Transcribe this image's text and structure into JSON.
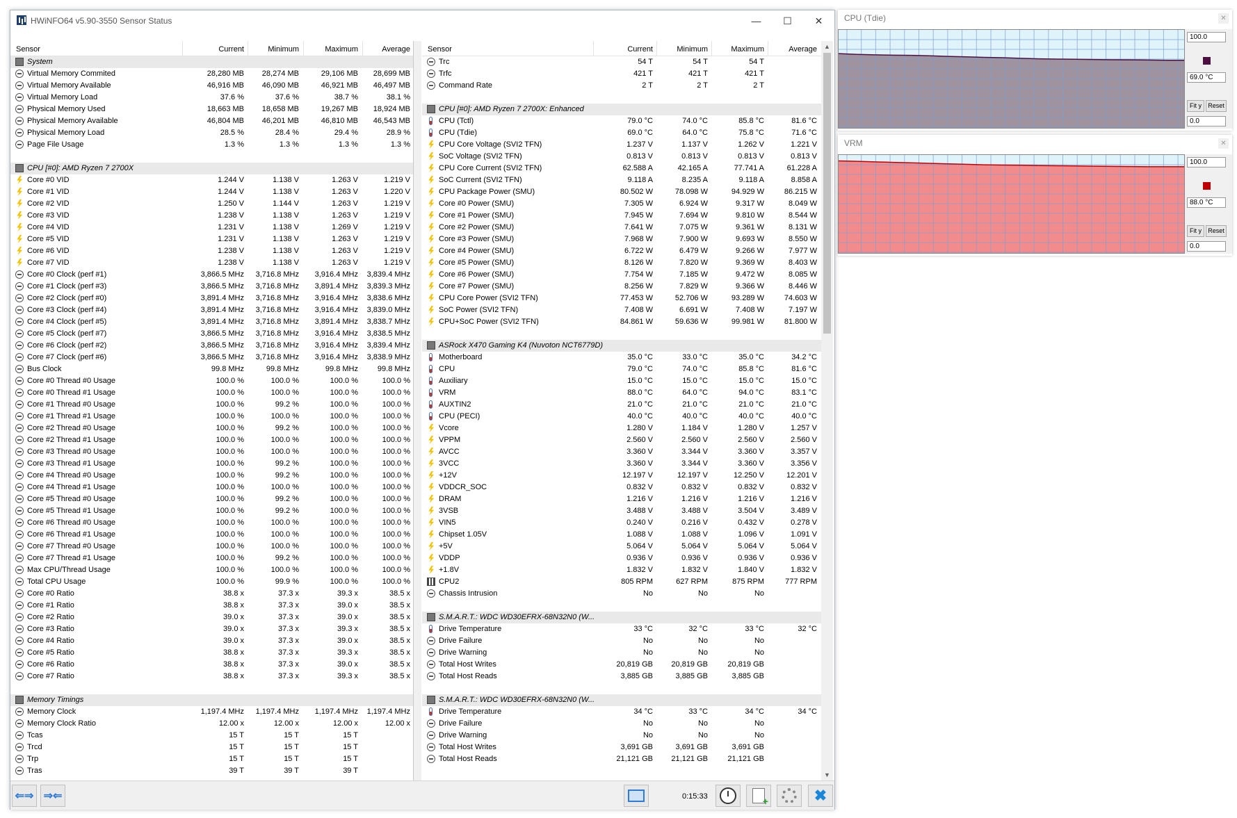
{
  "window": {
    "title": "HWiNFO64 v5.90-3550 Sensor Status",
    "minimize": "—",
    "maximize": "☐",
    "close": "✕"
  },
  "columns": {
    "sensor": "Sensor",
    "current": "Current",
    "minimum": "Minimum",
    "maximum": "Maximum",
    "average": "Average"
  },
  "left_rows": [
    {
      "g": true,
      "n": "System"
    },
    {
      "i": "c",
      "n": "Virtual Memory Commited",
      "c": "28,280 MB",
      "mi": "28,274 MB",
      "ma": "29,106 MB",
      "a": "28,699 MB"
    },
    {
      "i": "c",
      "n": "Virtual Memory Available",
      "c": "46,916 MB",
      "mi": "46,090 MB",
      "ma": "46,921 MB",
      "a": "46,497 MB"
    },
    {
      "i": "c",
      "n": "Virtual Memory Load",
      "c": "37.6 %",
      "mi": "37.6 %",
      "ma": "38.7 %",
      "a": "38.1 %"
    },
    {
      "i": "c",
      "n": "Physical Memory Used",
      "c": "18,663 MB",
      "mi": "18,658 MB",
      "ma": "19,267 MB",
      "a": "18,924 MB"
    },
    {
      "i": "c",
      "n": "Physical Memory Available",
      "c": "46,804 MB",
      "mi": "46,201 MB",
      "ma": "46,810 MB",
      "a": "46,543 MB"
    },
    {
      "i": "c",
      "n": "Physical Memory Load",
      "c": "28.5 %",
      "mi": "28.4 %",
      "ma": "29.4 %",
      "a": "28.9 %"
    },
    {
      "i": "c",
      "n": "Page File Usage",
      "c": "1.3 %",
      "mi": "1.3 %",
      "ma": "1.3 %",
      "a": "1.3 %"
    },
    {
      "b": true
    },
    {
      "g": true,
      "n": "CPU [#0]: AMD Ryzen 7 2700X"
    },
    {
      "i": "b",
      "n": "Core #0 VID",
      "c": "1.244 V",
      "mi": "1.138 V",
      "ma": "1.263 V",
      "a": "1.219 V"
    },
    {
      "i": "b",
      "n": "Core #1 VID",
      "c": "1.244 V",
      "mi": "1.138 V",
      "ma": "1.263 V",
      "a": "1.220 V"
    },
    {
      "i": "b",
      "n": "Core #2 VID",
      "c": "1.250 V",
      "mi": "1.144 V",
      "ma": "1.263 V",
      "a": "1.219 V"
    },
    {
      "i": "b",
      "n": "Core #3 VID",
      "c": "1.238 V",
      "mi": "1.138 V",
      "ma": "1.263 V",
      "a": "1.219 V"
    },
    {
      "i": "b",
      "n": "Core #4 VID",
      "c": "1.231 V",
      "mi": "1.138 V",
      "ma": "1.269 V",
      "a": "1.219 V"
    },
    {
      "i": "b",
      "n": "Core #5 VID",
      "c": "1.231 V",
      "mi": "1.138 V",
      "ma": "1.263 V",
      "a": "1.219 V"
    },
    {
      "i": "b",
      "n": "Core #6 VID",
      "c": "1.238 V",
      "mi": "1.138 V",
      "ma": "1.263 V",
      "a": "1.219 V"
    },
    {
      "i": "b",
      "n": "Core #7 VID",
      "c": "1.238 V",
      "mi": "1.138 V",
      "ma": "1.263 V",
      "a": "1.219 V"
    },
    {
      "i": "c",
      "n": "Core #0 Clock (perf #1)",
      "c": "3,866.5 MHz",
      "mi": "3,716.8 MHz",
      "ma": "3,916.4 MHz",
      "a": "3,839.4 MHz"
    },
    {
      "i": "c",
      "n": "Core #1 Clock (perf #3)",
      "c": "3,866.5 MHz",
      "mi": "3,716.8 MHz",
      "ma": "3,891.4 MHz",
      "a": "3,839.3 MHz"
    },
    {
      "i": "c",
      "n": "Core #2 Clock (perf #0)",
      "c": "3,891.4 MHz",
      "mi": "3,716.8 MHz",
      "ma": "3,916.4 MHz",
      "a": "3,838.6 MHz"
    },
    {
      "i": "c",
      "n": "Core #3 Clock (perf #4)",
      "c": "3,891.4 MHz",
      "mi": "3,716.8 MHz",
      "ma": "3,916.4 MHz",
      "a": "3,839.0 MHz"
    },
    {
      "i": "c",
      "n": "Core #4 Clock (perf #5)",
      "c": "3,891.4 MHz",
      "mi": "3,716.8 MHz",
      "ma": "3,891.4 MHz",
      "a": "3,838.7 MHz"
    },
    {
      "i": "c",
      "n": "Core #5 Clock (perf #7)",
      "c": "3,866.5 MHz",
      "mi": "3,716.8 MHz",
      "ma": "3,916.4 MHz",
      "a": "3,838.5 MHz"
    },
    {
      "i": "c",
      "n": "Core #6 Clock (perf #2)",
      "c": "3,866.5 MHz",
      "mi": "3,716.8 MHz",
      "ma": "3,916.4 MHz",
      "a": "3,839.4 MHz"
    },
    {
      "i": "c",
      "n": "Core #7 Clock (perf #6)",
      "c": "3,866.5 MHz",
      "mi": "3,716.8 MHz",
      "ma": "3,916.4 MHz",
      "a": "3,838.9 MHz"
    },
    {
      "i": "c",
      "n": "Bus Clock",
      "c": "99.8 MHz",
      "mi": "99.8 MHz",
      "ma": "99.8 MHz",
      "a": "99.8 MHz"
    },
    {
      "i": "c",
      "n": "Core #0 Thread #0 Usage",
      "c": "100.0 %",
      "mi": "100.0 %",
      "ma": "100.0 %",
      "a": "100.0 %"
    },
    {
      "i": "c",
      "n": "Core #0 Thread #1 Usage",
      "c": "100.0 %",
      "mi": "100.0 %",
      "ma": "100.0 %",
      "a": "100.0 %"
    },
    {
      "i": "c",
      "n": "Core #1 Thread #0 Usage",
      "c": "100.0 %",
      "mi": "99.2 %",
      "ma": "100.0 %",
      "a": "100.0 %"
    },
    {
      "i": "c",
      "n": "Core #1 Thread #1 Usage",
      "c": "100.0 %",
      "mi": "100.0 %",
      "ma": "100.0 %",
      "a": "100.0 %"
    },
    {
      "i": "c",
      "n": "Core #2 Thread #0 Usage",
      "c": "100.0 %",
      "mi": "99.2 %",
      "ma": "100.0 %",
      "a": "100.0 %"
    },
    {
      "i": "c",
      "n": "Core #2 Thread #1 Usage",
      "c": "100.0 %",
      "mi": "100.0 %",
      "ma": "100.0 %",
      "a": "100.0 %"
    },
    {
      "i": "c",
      "n": "Core #3 Thread #0 Usage",
      "c": "100.0 %",
      "mi": "100.0 %",
      "ma": "100.0 %",
      "a": "100.0 %"
    },
    {
      "i": "c",
      "n": "Core #3 Thread #1 Usage",
      "c": "100.0 %",
      "mi": "99.2 %",
      "ma": "100.0 %",
      "a": "100.0 %"
    },
    {
      "i": "c",
      "n": "Core #4 Thread #0 Usage",
      "c": "100.0 %",
      "mi": "99.2 %",
      "ma": "100.0 %",
      "a": "100.0 %"
    },
    {
      "i": "c",
      "n": "Core #4 Thread #1 Usage",
      "c": "100.0 %",
      "mi": "100.0 %",
      "ma": "100.0 %",
      "a": "100.0 %"
    },
    {
      "i": "c",
      "n": "Core #5 Thread #0 Usage",
      "c": "100.0 %",
      "mi": "99.2 %",
      "ma": "100.0 %",
      "a": "100.0 %"
    },
    {
      "i": "c",
      "n": "Core #5 Thread #1 Usage",
      "c": "100.0 %",
      "mi": "99.2 %",
      "ma": "100.0 %",
      "a": "100.0 %"
    },
    {
      "i": "c",
      "n": "Core #6 Thread #0 Usage",
      "c": "100.0 %",
      "mi": "100.0 %",
      "ma": "100.0 %",
      "a": "100.0 %"
    },
    {
      "i": "c",
      "n": "Core #6 Thread #1 Usage",
      "c": "100.0 %",
      "mi": "100.0 %",
      "ma": "100.0 %",
      "a": "100.0 %"
    },
    {
      "i": "c",
      "n": "Core #7 Thread #0 Usage",
      "c": "100.0 %",
      "mi": "100.0 %",
      "ma": "100.0 %",
      "a": "100.0 %"
    },
    {
      "i": "c",
      "n": "Core #7 Thread #1 Usage",
      "c": "100.0 %",
      "mi": "99.2 %",
      "ma": "100.0 %",
      "a": "100.0 %"
    },
    {
      "i": "c",
      "n": "Max CPU/Thread Usage",
      "c": "100.0 %",
      "mi": "100.0 %",
      "ma": "100.0 %",
      "a": "100.0 %"
    },
    {
      "i": "c",
      "n": "Total CPU Usage",
      "c": "100.0 %",
      "mi": "99.9 %",
      "ma": "100.0 %",
      "a": "100.0 %"
    },
    {
      "i": "c",
      "n": "Core #0 Ratio",
      "c": "38.8 x",
      "mi": "37.3 x",
      "ma": "39.3 x",
      "a": "38.5 x"
    },
    {
      "i": "c",
      "n": "Core #1 Ratio",
      "c": "38.8 x",
      "mi": "37.3 x",
      "ma": "39.0 x",
      "a": "38.5 x"
    },
    {
      "i": "c",
      "n": "Core #2 Ratio",
      "c": "39.0 x",
      "mi": "37.3 x",
      "ma": "39.0 x",
      "a": "38.5 x"
    },
    {
      "i": "c",
      "n": "Core #3 Ratio",
      "c": "39.0 x",
      "mi": "37.3 x",
      "ma": "39.3 x",
      "a": "38.5 x"
    },
    {
      "i": "c",
      "n": "Core #4 Ratio",
      "c": "39.0 x",
      "mi": "37.3 x",
      "ma": "39.0 x",
      "a": "38.5 x"
    },
    {
      "i": "c",
      "n": "Core #5 Ratio",
      "c": "38.8 x",
      "mi": "37.3 x",
      "ma": "39.3 x",
      "a": "38.5 x"
    },
    {
      "i": "c",
      "n": "Core #6 Ratio",
      "c": "38.8 x",
      "mi": "37.3 x",
      "ma": "39.0 x",
      "a": "38.5 x"
    },
    {
      "i": "c",
      "n": "Core #7 Ratio",
      "c": "38.8 x",
      "mi": "37.3 x",
      "ma": "39.3 x",
      "a": "38.5 x"
    },
    {
      "b": true
    },
    {
      "g": true,
      "n": "Memory Timings"
    },
    {
      "i": "c",
      "n": "Memory Clock",
      "c": "1,197.4 MHz",
      "mi": "1,197.4 MHz",
      "ma": "1,197.4 MHz",
      "a": "1,197.4 MHz"
    },
    {
      "i": "c",
      "n": "Memory Clock Ratio",
      "c": "12.00 x",
      "mi": "12.00 x",
      "ma": "12.00 x",
      "a": "12.00 x"
    },
    {
      "i": "c",
      "n": "Tcas",
      "c": "15 T",
      "mi": "15 T",
      "ma": "15 T",
      "a": ""
    },
    {
      "i": "c",
      "n": "Trcd",
      "c": "15 T",
      "mi": "15 T",
      "ma": "15 T",
      "a": ""
    },
    {
      "i": "c",
      "n": "Trp",
      "c": "15 T",
      "mi": "15 T",
      "ma": "15 T",
      "a": ""
    },
    {
      "i": "c",
      "n": "Tras",
      "c": "39 T",
      "mi": "39 T",
      "ma": "39 T",
      "a": ""
    }
  ],
  "right_rows": [
    {
      "i": "c",
      "n": "Trc",
      "c": "54 T",
      "mi": "54 T",
      "ma": "54 T",
      "a": ""
    },
    {
      "i": "c",
      "n": "Trfc",
      "c": "421 T",
      "mi": "421 T",
      "ma": "421 T",
      "a": ""
    },
    {
      "i": "c",
      "n": "Command Rate",
      "c": "2 T",
      "mi": "2 T",
      "ma": "2 T",
      "a": ""
    },
    {
      "b": true
    },
    {
      "g": true,
      "n": "CPU [#0]: AMD Ryzen 7 2700X: Enhanced"
    },
    {
      "i": "t",
      "n": "CPU (Tctl)",
      "c": "79.0 °C",
      "mi": "74.0 °C",
      "ma": "85.8 °C",
      "a": "81.6 °C"
    },
    {
      "i": "t",
      "n": "CPU (Tdie)",
      "c": "69.0 °C",
      "mi": "64.0 °C",
      "ma": "75.8 °C",
      "a": "71.6 °C"
    },
    {
      "i": "b",
      "n": "CPU Core Voltage (SVI2 TFN)",
      "c": "1.237 V",
      "mi": "1.137 V",
      "ma": "1.262 V",
      "a": "1.221 V"
    },
    {
      "i": "b",
      "n": "SoC Voltage (SVI2 TFN)",
      "c": "0.813 V",
      "mi": "0.813 V",
      "ma": "0.813 V",
      "a": "0.813 V"
    },
    {
      "i": "b",
      "n": "CPU Core Current (SVI2 TFN)",
      "c": "62.588 A",
      "mi": "42.165 A",
      "ma": "77.741 A",
      "a": "61.228 A"
    },
    {
      "i": "b",
      "n": "SoC Current (SVI2 TFN)",
      "c": "9.118 A",
      "mi": "8.235 A",
      "ma": "9.118 A",
      "a": "8.858 A"
    },
    {
      "i": "b",
      "n": "CPU Package Power (SMU)",
      "c": "80.502 W",
      "mi": "78.098 W",
      "ma": "94.929 W",
      "a": "86.215 W"
    },
    {
      "i": "b",
      "n": "Core #0 Power (SMU)",
      "c": "7.305 W",
      "mi": "6.924 W",
      "ma": "9.317 W",
      "a": "8.049 W"
    },
    {
      "i": "b",
      "n": "Core #1 Power (SMU)",
      "c": "7.945 W",
      "mi": "7.694 W",
      "ma": "9.810 W",
      "a": "8.544 W"
    },
    {
      "i": "b",
      "n": "Core #2 Power (SMU)",
      "c": "7.641 W",
      "mi": "7.075 W",
      "ma": "9.361 W",
      "a": "8.131 W"
    },
    {
      "i": "b",
      "n": "Core #3 Power (SMU)",
      "c": "7.968 W",
      "mi": "7.900 W",
      "ma": "9.693 W",
      "a": "8.550 W"
    },
    {
      "i": "b",
      "n": "Core #4 Power (SMU)",
      "c": "6.722 W",
      "mi": "6.479 W",
      "ma": "9.266 W",
      "a": "7.977 W"
    },
    {
      "i": "b",
      "n": "Core #5 Power (SMU)",
      "c": "8.126 W",
      "mi": "7.820 W",
      "ma": "9.369 W",
      "a": "8.403 W"
    },
    {
      "i": "b",
      "n": "Core #6 Power (SMU)",
      "c": "7.754 W",
      "mi": "7.185 W",
      "ma": "9.472 W",
      "a": "8.085 W"
    },
    {
      "i": "b",
      "n": "Core #7 Power (SMU)",
      "c": "8.256 W",
      "mi": "7.829 W",
      "ma": "9.366 W",
      "a": "8.446 W"
    },
    {
      "i": "b",
      "n": "CPU Core Power (SVI2 TFN)",
      "c": "77.453 W",
      "mi": "52.706 W",
      "ma": "93.289 W",
      "a": "74.603 W"
    },
    {
      "i": "b",
      "n": "SoC Power (SVI2 TFN)",
      "c": "7.408 W",
      "mi": "6.691 W",
      "ma": "7.408 W",
      "a": "7.197 W"
    },
    {
      "i": "b",
      "n": "CPU+SoC Power (SVI2 TFN)",
      "c": "84.861 W",
      "mi": "59.636 W",
      "ma": "99.981 W",
      "a": "81.800 W"
    },
    {
      "b": true
    },
    {
      "g": true,
      "n": "ASRock X470 Gaming K4 (Nuvoton NCT6779D)"
    },
    {
      "i": "t",
      "n": "Motherboard",
      "c": "35.0 °C",
      "mi": "33.0 °C",
      "ma": "35.0 °C",
      "a": "34.2 °C"
    },
    {
      "i": "t",
      "n": "CPU",
      "c": "79.0 °C",
      "mi": "74.0 °C",
      "ma": "85.8 °C",
      "a": "81.6 °C"
    },
    {
      "i": "t",
      "n": "Auxiliary",
      "c": "15.0 °C",
      "mi": "15.0 °C",
      "ma": "15.0 °C",
      "a": "15.0 °C"
    },
    {
      "i": "t",
      "n": "VRM",
      "c": "88.0 °C",
      "mi": "64.0 °C",
      "ma": "94.0 °C",
      "a": "83.1 °C"
    },
    {
      "i": "t",
      "n": "AUXTIN2",
      "c": "21.0 °C",
      "mi": "21.0 °C",
      "ma": "21.0 °C",
      "a": "21.0 °C"
    },
    {
      "i": "t",
      "n": "CPU (PECI)",
      "c": "40.0 °C",
      "mi": "40.0 °C",
      "ma": "40.0 °C",
      "a": "40.0 °C"
    },
    {
      "i": "b",
      "n": "Vcore",
      "c": "1.280 V",
      "mi": "1.184 V",
      "ma": "1.280 V",
      "a": "1.257 V"
    },
    {
      "i": "b",
      "n": "VPPM",
      "c": "2.560 V",
      "mi": "2.560 V",
      "ma": "2.560 V",
      "a": "2.560 V"
    },
    {
      "i": "b",
      "n": "AVCC",
      "c": "3.360 V",
      "mi": "3.344 V",
      "ma": "3.360 V",
      "a": "3.357 V"
    },
    {
      "i": "b",
      "n": "3VCC",
      "c": "3.360 V",
      "mi": "3.344 V",
      "ma": "3.360 V",
      "a": "3.356 V"
    },
    {
      "i": "b",
      "n": "+12V",
      "c": "12.197 V",
      "mi": "12.197 V",
      "ma": "12.250 V",
      "a": "12.201 V"
    },
    {
      "i": "b",
      "n": "VDDCR_SOC",
      "c": "0.832 V",
      "mi": "0.832 V",
      "ma": "0.832 V",
      "a": "0.832 V"
    },
    {
      "i": "b",
      "n": "DRAM",
      "c": "1.216 V",
      "mi": "1.216 V",
      "ma": "1.216 V",
      "a": "1.216 V"
    },
    {
      "i": "b",
      "n": "3VSB",
      "c": "3.488 V",
      "mi": "3.488 V",
      "ma": "3.504 V",
      "a": "3.489 V"
    },
    {
      "i": "b",
      "n": "VIN5",
      "c": "0.240 V",
      "mi": "0.216 V",
      "ma": "0.432 V",
      "a": "0.278 V"
    },
    {
      "i": "b",
      "n": "Chipset 1.05V",
      "c": "1.088 V",
      "mi": "1.088 V",
      "ma": "1.096 V",
      "a": "1.091 V"
    },
    {
      "i": "b",
      "n": "+5V",
      "c": "5.064 V",
      "mi": "5.064 V",
      "ma": "5.064 V",
      "a": "5.064 V"
    },
    {
      "i": "b",
      "n": "VDDP",
      "c": "0.936 V",
      "mi": "0.936 V",
      "ma": "0.936 V",
      "a": "0.936 V"
    },
    {
      "i": "b",
      "n": "+1.8V",
      "c": "1.832 V",
      "mi": "1.832 V",
      "ma": "1.840 V",
      "a": "1.832 V"
    },
    {
      "i": "f",
      "n": "CPU2",
      "c": "805 RPM",
      "mi": "627 RPM",
      "ma": "875 RPM",
      "a": "777 RPM"
    },
    {
      "i": "c",
      "n": "Chassis Intrusion",
      "c": "No",
      "mi": "No",
      "ma": "No",
      "a": ""
    },
    {
      "b": true
    },
    {
      "g": true,
      "n": "S.M.A.R.T.: WDC WD30EFRX-68N32N0 (W..."
    },
    {
      "i": "t",
      "n": "Drive Temperature",
      "c": "33 °C",
      "mi": "32 °C",
      "ma": "33 °C",
      "a": "32 °C"
    },
    {
      "i": "c",
      "n": "Drive Failure",
      "c": "No",
      "mi": "No",
      "ma": "No",
      "a": ""
    },
    {
      "i": "c",
      "n": "Drive Warning",
      "c": "No",
      "mi": "No",
      "ma": "No",
      "a": ""
    },
    {
      "i": "c",
      "n": "Total Host Writes",
      "c": "20,819 GB",
      "mi": "20,819 GB",
      "ma": "20,819 GB",
      "a": ""
    },
    {
      "i": "c",
      "n": "Total Host Reads",
      "c": "3,885 GB",
      "mi": "3,885 GB",
      "ma": "3,885 GB",
      "a": ""
    },
    {
      "b": true
    },
    {
      "g": true,
      "n": "S.M.A.R.T.: WDC WD30EFRX-68N32N0 (W..."
    },
    {
      "i": "t",
      "n": "Drive Temperature",
      "c": "34 °C",
      "mi": "33 °C",
      "ma": "34 °C",
      "a": "34 °C"
    },
    {
      "i": "c",
      "n": "Drive Failure",
      "c": "No",
      "mi": "No",
      "ma": "No",
      "a": ""
    },
    {
      "i": "c",
      "n": "Drive Warning",
      "c": "No",
      "mi": "No",
      "ma": "No",
      "a": ""
    },
    {
      "i": "c",
      "n": "Total Host Writes",
      "c": "3,691 GB",
      "mi": "3,691 GB",
      "ma": "3,691 GB",
      "a": ""
    },
    {
      "i": "c",
      "n": "Total Host Reads",
      "c": "21,121 GB",
      "mi": "21,121 GB",
      "ma": "21,121 GB",
      "a": ""
    }
  ],
  "toolbar": {
    "elapsed": "0:15:33",
    "nav_left_glyph": "⇐⇒",
    "nav_right_glyph": "⇒⇐",
    "close_glyph": "✖"
  },
  "graphs": [
    {
      "title": "CPU (Tdie)",
      "close_glyph": "✕",
      "max_box": "100.0",
      "current_box": "69.0 °C",
      "min_box": "0.0",
      "fit_label": "Fit y",
      "reset_label": "Reset",
      "fill_color": "#9f939f",
      "line_color": "#4b1040",
      "bg_color": "#dff3fb",
      "y_min": 0,
      "y_max": 100,
      "values": [
        75.8,
        75.0,
        74.6,
        74.2,
        74.0,
        73.6,
        73.0,
        72.5,
        72.0,
        71.6,
        71.0,
        70.5,
        70.2,
        70.0,
        69.8,
        69.5,
        69.4,
        69.2,
        69.0,
        69.0
      ]
    },
    {
      "title": "VRM",
      "close_glyph": "✕",
      "max_box": "100.0",
      "current_box": "88.0 °C",
      "min_box": "0.0",
      "fit_label": "Fit y",
      "reset_label": "Reset",
      "fill_color": "#f28c8c",
      "line_color": "#c00000",
      "bg_color": "#dff3fb",
      "y_min": 0,
      "y_max": 100,
      "values": [
        94.0,
        93.5,
        93.0,
        92.5,
        92.0,
        91.5,
        91.0,
        90.5,
        90.0,
        89.7,
        89.5,
        89.2,
        89.0,
        88.8,
        88.6,
        88.4,
        88.2,
        88.0,
        88.0,
        88.0
      ]
    }
  ]
}
